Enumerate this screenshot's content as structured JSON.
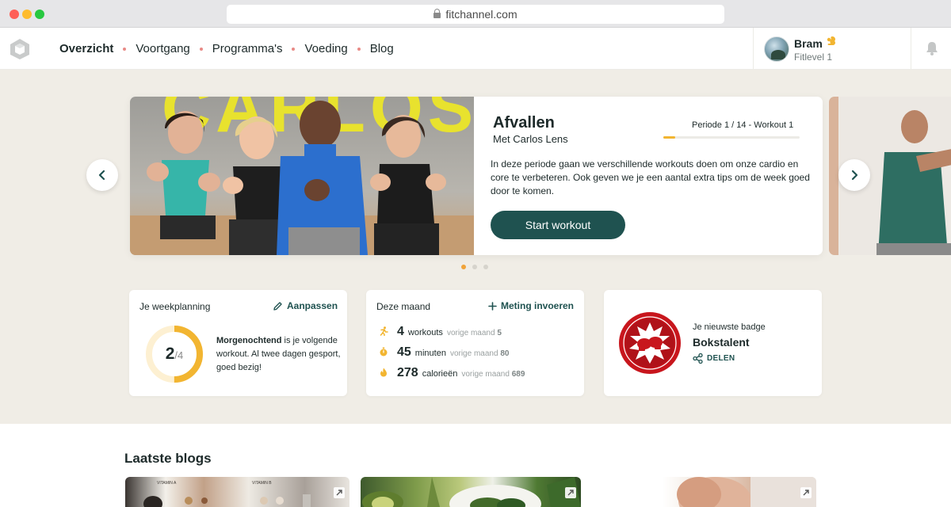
{
  "browser": {
    "url": "fitchannel.com"
  },
  "nav": {
    "items": [
      "Overzicht",
      "Voortgang",
      "Programma's",
      "Voeding",
      "Blog"
    ],
    "active": "Overzicht"
  },
  "user": {
    "name": "Bram",
    "level": "Fitlevel 1"
  },
  "hero": {
    "program_title": "Afvallen",
    "trainer": "Met Carlos Lens",
    "period_label": "Periode 1 / 14 - Workout 1",
    "progress": 0.09,
    "description": "In deze periode gaan we verschillende workouts doen om onze cardio en core te verbeteren. Ook geven we je een aantal extra tips om de week goed door te komen.",
    "start_button": "Start workout",
    "photo_text": "CARLOS",
    "slides_total": 3,
    "slide_active": 1
  },
  "week_card": {
    "label": "Je weekplanning",
    "action": "Aanpassen",
    "done": "2",
    "total": "/4",
    "completion": 0.5,
    "highlight": "Morgenochtend",
    "text": " is je volgende workout. Al twee dagen gesport, goed bezig!"
  },
  "month_card": {
    "label": "Deze maand",
    "action": "Meting invoeren",
    "stats": [
      {
        "icon": "running-icon",
        "value": "4",
        "unit": "workouts",
        "prev_label": "vorige maand",
        "prev_value": "5"
      },
      {
        "icon": "stopwatch-icon",
        "value": "45",
        "unit": "minuten",
        "prev_label": "vorige maand",
        "prev_value": "80"
      },
      {
        "icon": "flame-icon",
        "value": "278",
        "unit": "calorieën",
        "prev_label": "vorige maand",
        "prev_value": "689"
      }
    ]
  },
  "badge_card": {
    "label": "Je nieuwste badge",
    "badge_name": "Bokstalent",
    "share": "DELEN"
  },
  "blogs": {
    "title": "Laatste blogs",
    "photo_captions": [
      "VITAMIN A",
      "VITAMIN B"
    ]
  },
  "colors": {
    "primary": "#1f5250",
    "accent": "#f2b531",
    "hero_bg": "#f0ede6",
    "badge_red": "#c8161d"
  }
}
